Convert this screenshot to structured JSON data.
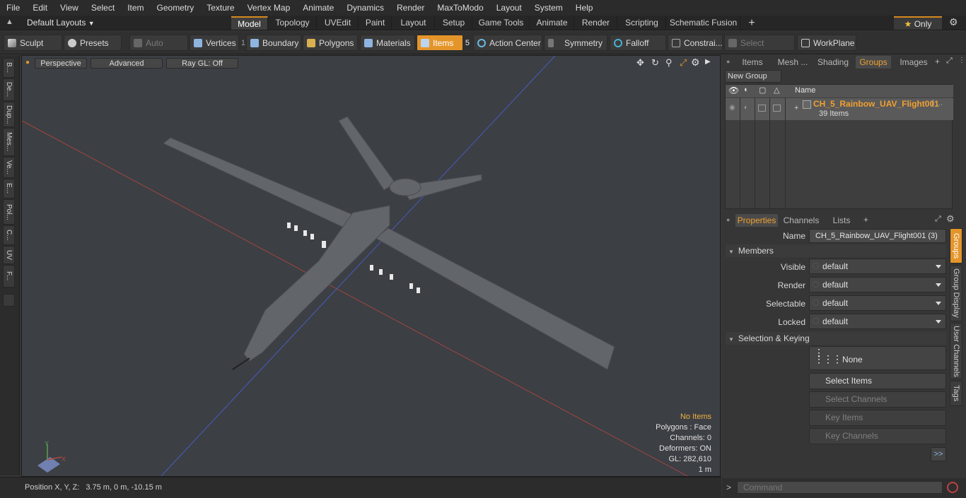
{
  "menu": [
    "File",
    "Edit",
    "View",
    "Select",
    "Item",
    "Geometry",
    "Texture",
    "Vertex Map",
    "Animate",
    "Dynamics",
    "Render",
    "MaxToModo",
    "Layout",
    "System",
    "Help"
  ],
  "layouts": {
    "dropdown": "Default Layouts",
    "tabs": [
      "Model",
      "Topology",
      "UVEdit",
      "Paint",
      "Layout",
      "Setup",
      "Game Tools",
      "Animate",
      "Render",
      "Scripting",
      "Schematic Fusion"
    ],
    "active_tab": "Model",
    "add": "+",
    "only_label": "Only"
  },
  "toolbar": {
    "sculpt": "Sculpt",
    "presets": "Presets",
    "auto_select": "Auto Select",
    "vertices": "Vertices",
    "vertices_count": "1",
    "boundary": "Boundary",
    "polygons": "Polygons",
    "materials": "Materials",
    "items": "Items",
    "items_count": "5",
    "action_center": "Action Center",
    "symmetry": "Symmetry",
    "falloff": "Falloff",
    "constraints": "Constrai...",
    "select_through": "Select Through",
    "workplane": "WorkPlane"
  },
  "left_tabs": [
    "B...",
    "De...",
    "Dup...",
    "Mes...",
    "Ve...",
    "E...",
    "Pol...",
    "C...",
    "UV",
    "F..."
  ],
  "viewport": {
    "view": "Perspective",
    "shading": "Advanced",
    "raygl": "Ray GL: Off",
    "info": {
      "no_items": "No Items",
      "polygons": "Polygons : Face",
      "channels": "Channels: 0",
      "deformers": "Deformers: ON",
      "gl": "GL: 282,610",
      "scale": "1 m"
    },
    "axis": {
      "y": "Y",
      "x": "X"
    }
  },
  "status": {
    "position_label": "Position X, Y, Z:",
    "position_value": "3.75 m, 0 m, -10.15 m"
  },
  "right_top": {
    "tabs": [
      "Items",
      "Mesh ...",
      "Shading",
      "Groups",
      "Images"
    ],
    "active_tab": "Groups",
    "new_group": "New Group",
    "col_name": "Name",
    "group_name": "CH_5_Rainbow_UAV_Flight001",
    "group_suffix": "( ...",
    "group_count": "39 Items"
  },
  "properties": {
    "tabs": [
      "Properties",
      "Channels",
      "Lists"
    ],
    "active_tab": "Properties",
    "name_label": "Name",
    "name_value": "CH_5_Rainbow_UAV_Flight001 (3)",
    "members_section": "Members",
    "fields": [
      {
        "label": "Visible",
        "value": "default"
      },
      {
        "label": "Render",
        "value": "default"
      },
      {
        "label": "Selectable",
        "value": "default"
      },
      {
        "label": "Locked",
        "value": "default"
      }
    ],
    "sel_section": "Selection & Keying",
    "none_label": "None",
    "select_items": "Select Items",
    "select_channels": "Select Channels",
    "key_items": "Key Items",
    "key_channels": "Key Channels",
    "more": ">>",
    "side_tabs": [
      "Groups",
      "Group Display",
      "User Channels",
      "Tags"
    ],
    "active_side_tab": "Groups"
  },
  "command": {
    "placeholder": "Command",
    "prompt": ">"
  },
  "colors": {
    "accent": "#e4952a",
    "group_name": "#f0a030",
    "viewport_bg": "#3c3f44"
  }
}
